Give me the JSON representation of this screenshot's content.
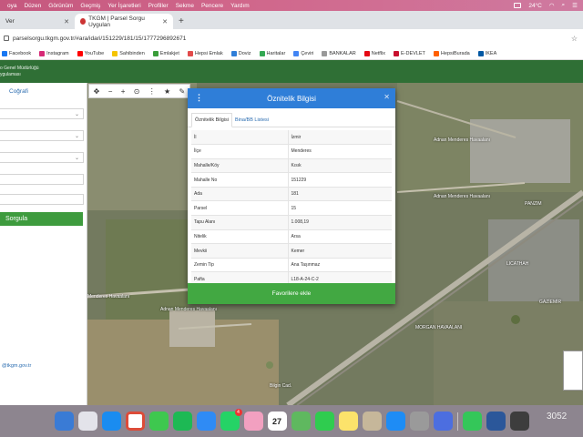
{
  "menubar": {
    "items": [
      "oya",
      "Düzen",
      "Görünüm",
      "Geçmiş",
      "Yer İşaretleri",
      "Profiller",
      "Sekme",
      "Pencere",
      "Yardım"
    ],
    "temperature": "24°C"
  },
  "tabs": {
    "inactive_label": "Ver",
    "active_label": "TKGM | Parsel Sorgu Uygulan"
  },
  "address": {
    "url": "parselsorgu.tkgm.gov.tr/#ara/idari/151229/181/15/1777296892671"
  },
  "bookmarks": [
    {
      "label": "Facebook",
      "color": "#1877f2"
    },
    {
      "label": "Instagram",
      "color": "#d62976"
    },
    {
      "label": "YouTube",
      "color": "#ff0000"
    },
    {
      "label": "Sahibinden",
      "color": "#f5c400"
    },
    {
      "label": "Emlakjet",
      "color": "#3a9d3a"
    },
    {
      "label": "Hepsi Emlak",
      "color": "#e24b4b"
    },
    {
      "label": "Doviz",
      "color": "#2f7ed8"
    },
    {
      "label": "Haritalar",
      "color": "#34a853"
    },
    {
      "label": "Çeviri",
      "color": "#4285f4"
    },
    {
      "label": "BANKALAR",
      "color": "#999999"
    },
    {
      "label": "Netflix",
      "color": "#e50914"
    },
    {
      "label": "E-DEVLET",
      "color": "#c8102e"
    },
    {
      "label": "HepsiBurada",
      "color": "#ff6000"
    },
    {
      "label": "IKEA",
      "color": "#0058a3"
    }
  ],
  "site": {
    "header_line1": "o Genel Müdürlüğü",
    "header_line2": "ygulaması",
    "left_tab": "Coğrafi",
    "search_button": "Sorgula",
    "footer_email": "@tkgm.gov.tr"
  },
  "map": {
    "labels": [
      "Adnan Menderes Havaalanı",
      "Adnan Menderes Havaalanı",
      "Menderes Havaalanı",
      "MORGAN HAVAALANI",
      "PANZIM",
      "LICATHAH",
      "Bilgin Cad.",
      "GAZİEMİR",
      "Adnan Menderes Havaalanı"
    ]
  },
  "dialog": {
    "title": "Öznitelik Bilgisi",
    "tab_active": "Öznitelik Bilgisi",
    "tab_inactive": "Bina/BB Listesi",
    "rows": [
      {
        "key": "İl",
        "value": "İzmir"
      },
      {
        "key": "İlçe",
        "value": "Menderes"
      },
      {
        "key": "Mahalle/Köy",
        "value": "Kısık"
      },
      {
        "key": "Mahalle No",
        "value": "151229"
      },
      {
        "key": "Ada",
        "value": "181"
      },
      {
        "key": "Parsel",
        "value": "15"
      },
      {
        "key": "Tapu Alanı",
        "value": "1.008,19"
      },
      {
        "key": "Nitelik",
        "value": "Arsa"
      },
      {
        "key": "Mevkii",
        "value": "Kemer"
      },
      {
        "key": "Zemin Tip",
        "value": "Ana Taşınmaz"
      },
      {
        "key": "Pafta",
        "value": "L18-A-24-C-2"
      }
    ],
    "favorite_button": "Favorilere ekle"
  },
  "dock": {
    "calendar_day": "27",
    "whatsapp_badge": "4",
    "corner_text": "3052"
  }
}
